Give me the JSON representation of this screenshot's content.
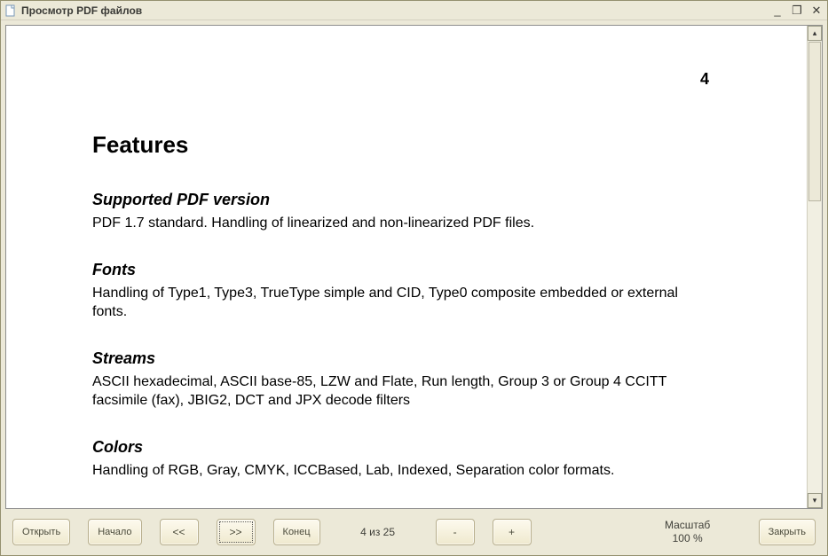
{
  "window": {
    "title": "Просмотр PDF файлов"
  },
  "document": {
    "page_number": "4",
    "heading": "Features",
    "sections": {
      "s0": {
        "title": "Supported PDF version",
        "body": "PDF 1.7 standard. Handling of linearized and non-linearized PDF files."
      },
      "s1": {
        "title": "Fonts",
        "body": "Handling of Type1, Type3, TrueType simple and CID, Type0 composite embedded or external fonts."
      },
      "s2": {
        "title": "Streams",
        "body": "ASCII hexadecimal, ASCII base-85, LZW and Flate,  Run length, Group 3 or Group 4 CCITT facsimile (fax), JBIG2, DCT and JPX decode filters"
      },
      "s3": {
        "title": "Colors",
        "body": "Handling of RGB, Gray, CMYK, ICCBased, Lab, Indexed, Separation  color formats."
      }
    }
  },
  "toolbar": {
    "open": "Открыть",
    "first": "Начало",
    "prev": "<<",
    "next": ">>",
    "last": "Конец",
    "page_indicator": "4 из 25",
    "zoom_out": "-",
    "zoom_in": "+",
    "zoom_label": "Масштаб",
    "zoom_value": "100 %",
    "close": "Закрыть"
  },
  "titlebar_controls": {
    "minimize": "_",
    "maximize": "❐",
    "close": "✕"
  }
}
